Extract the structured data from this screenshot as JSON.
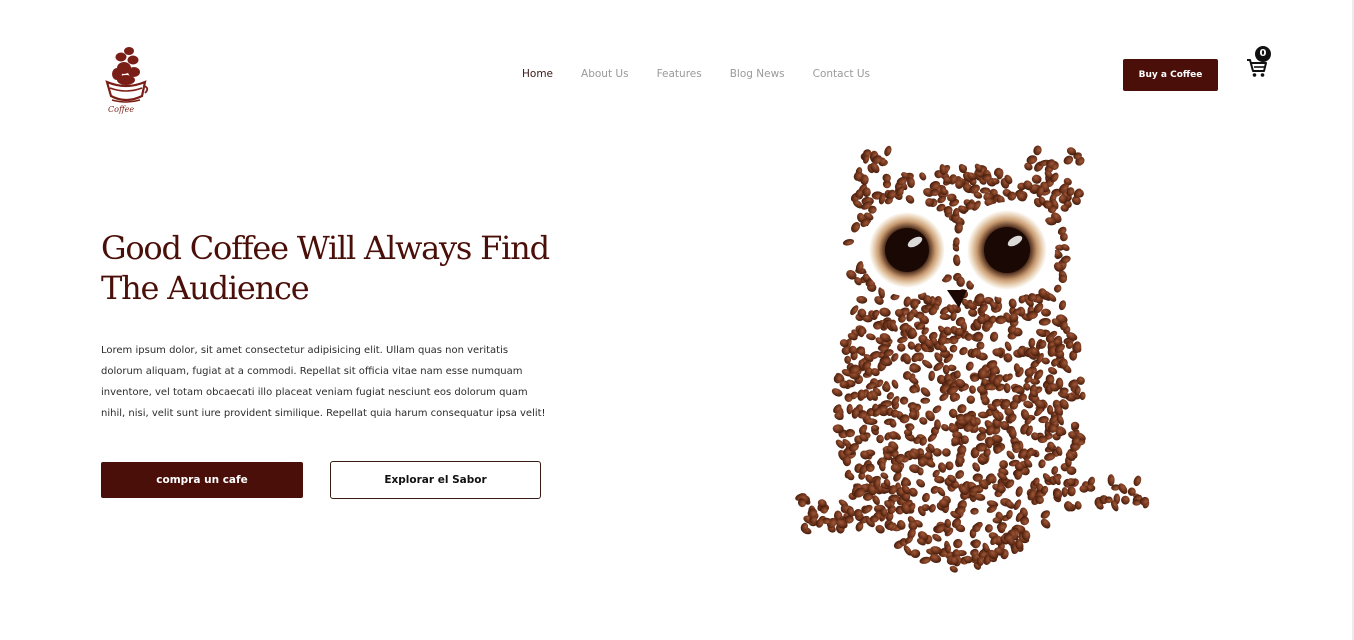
{
  "brand": {
    "logo_text": "Coffee",
    "logo_icon": "coffee-cup-logo"
  },
  "nav": {
    "items": [
      {
        "label": "Home",
        "active": true
      },
      {
        "label": "About Us",
        "active": false
      },
      {
        "label": "Features",
        "active": false
      },
      {
        "label": "Blog News",
        "active": false
      },
      {
        "label": "Contact Us",
        "active": false
      }
    ]
  },
  "header": {
    "buy_label": "Buy a Coffee",
    "cart_count": "0",
    "cart_icon": "shopping-cart-icon"
  },
  "hero": {
    "title_line1": "Good Coffee Will Always Find",
    "title_line2": "The Audience",
    "text_lines": [
      "Lorem ipsum dolor, sit amet consectetur adipisicing elit. Ullam quas non veritatis",
      "dolorum aliquam, fugiat at a commodi. Repellat sit officia vitae nam esse numquam",
      "inventore, vel totam obcaecati illo placeat veniam fugiat nesciunt eos dolorum quam",
      "nihil, nisi, velit sunt iure provident similique. Repellat quia harum consequatur ipsa velit!"
    ],
    "primary_button": "compra un cafe",
    "secondary_button": "Explorar el Sabor",
    "image": "coffee-bean-owl"
  },
  "colors": {
    "brand_dark": "#4a0f08",
    "nav_inactive": "#9a9a9a",
    "bean": "#6b3219"
  }
}
